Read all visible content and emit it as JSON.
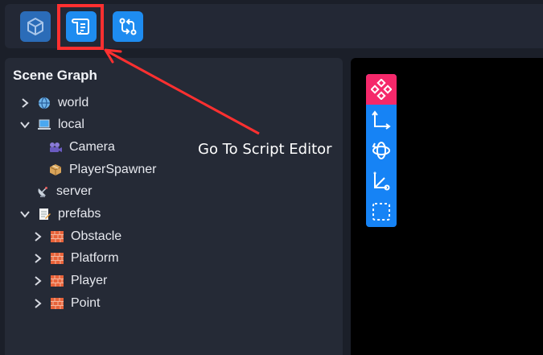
{
  "toolbar": {
    "buttons": [
      {
        "name": "scene-view",
        "icon": "cube-icon"
      },
      {
        "name": "script-editor",
        "icon": "script-scroll-icon"
      },
      {
        "name": "swap",
        "icon": "swap-arrows-icon"
      }
    ]
  },
  "scene_graph": {
    "title": "Scene Graph",
    "items": [
      {
        "label": "world",
        "icon": "globe-icon",
        "expanded": false
      },
      {
        "label": "local",
        "icon": "laptop-icon",
        "expanded": true
      },
      {
        "label": "Camera",
        "icon": "camera-icon"
      },
      {
        "label": "PlayerSpawner",
        "icon": "package-icon"
      },
      {
        "label": "server",
        "icon": "satellite-dish-icon"
      },
      {
        "label": "prefabs",
        "icon": "memo-icon",
        "expanded": true
      },
      {
        "label": "Obstacle",
        "icon": "brick-icon",
        "expanded": false
      },
      {
        "label": "Platform",
        "icon": "brick-icon",
        "expanded": false
      },
      {
        "label": "Player",
        "icon": "brick-icon",
        "expanded": false
      },
      {
        "label": "Point",
        "icon": "brick-icon",
        "expanded": false
      }
    ]
  },
  "viewport_tools": [
    {
      "name": "transform",
      "icon": "move-diamond-icon",
      "active": true
    },
    {
      "name": "translate",
      "icon": "axis-arrows-icon",
      "active": false
    },
    {
      "name": "rotate",
      "icon": "rotate-orbit-icon",
      "active": false
    },
    {
      "name": "scale",
      "icon": "scale-axis-icon",
      "active": false
    },
    {
      "name": "select",
      "icon": "dashed-select-icon",
      "active": false
    }
  ],
  "annotation": {
    "text": "Go To Script Editor",
    "color": "#ff3030"
  },
  "colors": {
    "accent": "#1e8cf0",
    "active_tool": "#f5286a",
    "panel": "#252a36"
  }
}
